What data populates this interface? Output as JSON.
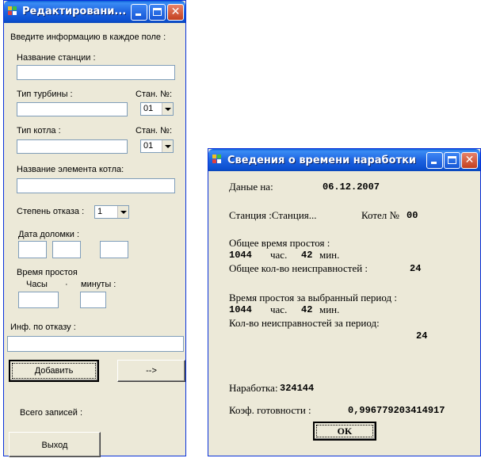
{
  "edit_window": {
    "title": "Редактировани...",
    "instructions": "Введите информацию в каждое поле :",
    "station_name_label": "Название станции :",
    "turbine_type_label": "Тип турбины :",
    "turbine_station_no_label": "Стан. №:",
    "turbine_station_no_value": "01",
    "boiler_type_label": "Тип котла :",
    "boiler_station_no_label": "Стан. №:",
    "boiler_station_no_value": "01",
    "boiler_element_label": "Название элемента котла:",
    "failure_degree_label": "Степень отказа :",
    "failure_degree_value": "1",
    "break_date_label": "Дата доломки :",
    "downtime_label": "Время простоя",
    "hours_label": "Часы",
    "minutes_label": "минуты :",
    "failure_info_label": "Инф. по отказу :",
    "add_button": "Добавить",
    "next_button": "-->",
    "total_records_label": "Всего записей :",
    "exit_button": "Выход"
  },
  "info_window": {
    "title": "Сведения о времени наработки",
    "data_on_label": "Даные на:",
    "data_on_value": "06.12.2007",
    "station_label": "Станция :Станция...",
    "boiler_label": "Котел №",
    "boiler_value": "00",
    "total_downtime_label": "Общее время простоя :",
    "total_hours": "1044",
    "hours_unit": "час.",
    "total_minutes": "42",
    "minutes_unit": "мин.",
    "total_faults_label": "Общее кол-во неисправностей :",
    "total_faults_value": "24",
    "period_downtime_label": "Время простоя за выбранный период :",
    "period_hours": "1044",
    "period_hours_unit": "час.",
    "period_minutes": "42",
    "period_minutes_unit": "мин.",
    "period_faults_label": "Кол-во неисправностей за период:",
    "period_faults_value": "24",
    "operating_time_label": "Наработка:",
    "operating_time_value": "324144",
    "availability_label": "Коэф. готовности :",
    "availability_value": "0,996779203414917",
    "ok_button": "OK"
  },
  "colors": {
    "titlebar": "#0a5fd8",
    "window_bg": "#ece9d8",
    "close_button": "#c3401f"
  }
}
